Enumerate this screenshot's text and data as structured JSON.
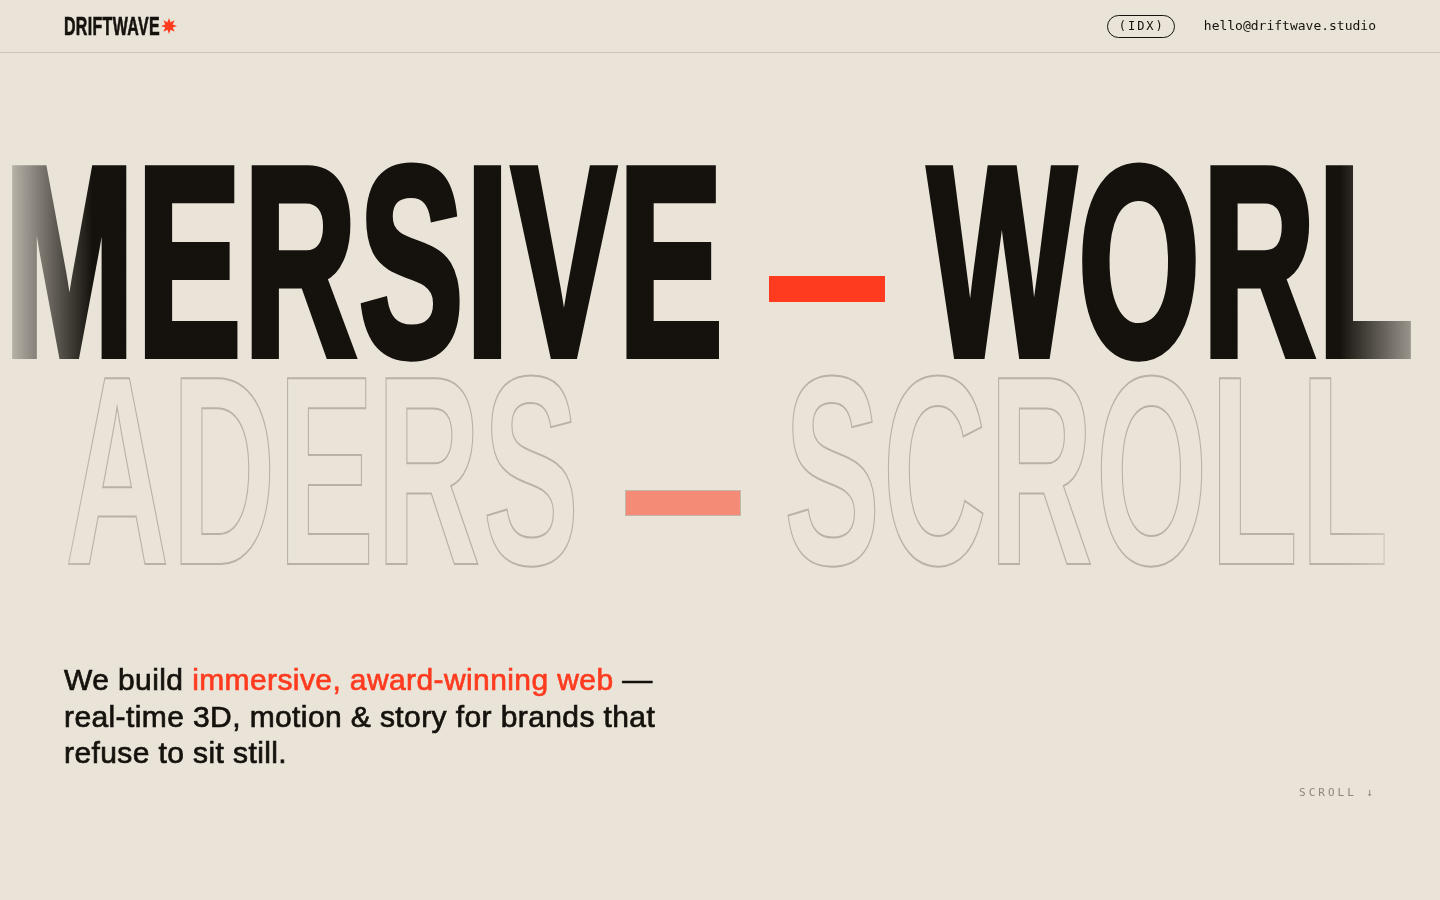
{
  "header": {
    "logo": "DRIFTWAVE",
    "index_button": "(IDX)",
    "email": "hello@driftwave.studio"
  },
  "marquee": [
    {
      "kind": "solid",
      "words": [
        "MERSIVE",
        "WORL"
      ]
    },
    {
      "kind": "outline",
      "words": [
        "ADERS",
        "SCROLL"
      ]
    }
  ],
  "intro": [
    {
      "text": "We build ",
      "accent": false
    },
    {
      "text": "immersive, award-winning web",
      "accent": true
    },
    {
      "text": " — real-time 3D, motion & story for brands that refuse to sit still.",
      "accent": false
    }
  ],
  "scroll_hint": "SCROLL ↓"
}
